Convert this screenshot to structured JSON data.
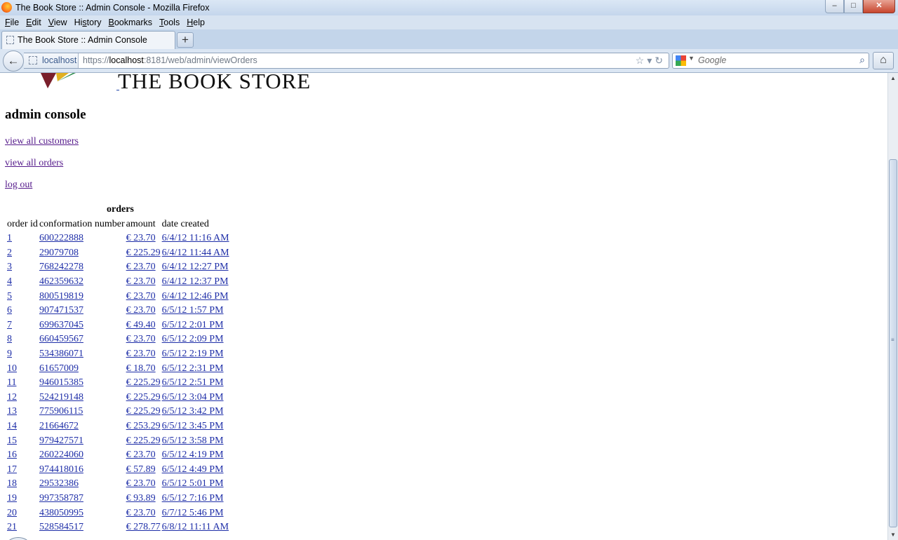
{
  "window": {
    "title": "The Book Store :: Admin Console - Mozilla Firefox",
    "controls": {
      "minimize": "–",
      "maximize": "□",
      "close": "✕"
    }
  },
  "menu": {
    "items": [
      {
        "label": "File",
        "accel": "F"
      },
      {
        "label": "Edit",
        "accel": "E"
      },
      {
        "label": "View",
        "accel": "V"
      },
      {
        "label": "History",
        "accel": "s"
      },
      {
        "label": "Bookmarks",
        "accel": "B"
      },
      {
        "label": "Tools",
        "accel": "T"
      },
      {
        "label": "Help",
        "accel": "H"
      }
    ]
  },
  "tabs": [
    {
      "label": "The Book Store :: Admin Console"
    }
  ],
  "new_tab_label": "+",
  "nav": {
    "back_icon": "back-arrow-icon",
    "identity_label": "localhost",
    "url_prefix": "https://",
    "url_host": "localhost",
    "url_rest": ":8181/web/admin/viewOrders",
    "search_placeholder": "Google",
    "home_icon": "home-icon"
  },
  "page": {
    "logo_text": "THE BOOK STORE",
    "heading": "admin console",
    "links": {
      "customers": "view all customers",
      "orders": "view all orders",
      "logout": "log out"
    },
    "orders_table": {
      "caption": "orders",
      "columns": [
        "order id",
        "conformation number",
        "amount",
        "date created"
      ],
      "rows": [
        [
          "1",
          "600222888",
          "€ 23.70",
          "6/4/12 11:16 AM"
        ],
        [
          "2",
          "29079708",
          "€ 225.29",
          "6/4/12 11:44 AM"
        ],
        [
          "3",
          "768242278",
          "€ 23.70",
          "6/4/12 12:27 PM"
        ],
        [
          "4",
          "462359632",
          "€ 23.70",
          "6/4/12 12:37 PM"
        ],
        [
          "5",
          "800519819",
          "€ 23.70",
          "6/4/12 12:46 PM"
        ],
        [
          "6",
          "907471537",
          "€ 23.70",
          "6/5/12 1:57 PM"
        ],
        [
          "7",
          "699637045",
          "€ 49.40",
          "6/5/12 2:01 PM"
        ],
        [
          "8",
          "660459567",
          "€ 23.70",
          "6/5/12 2:09 PM"
        ],
        [
          "9",
          "534386071",
          "€ 23.70",
          "6/5/12 2:19 PM"
        ],
        [
          "10",
          "61657009",
          "€ 18.70",
          "6/5/12 2:31 PM"
        ],
        [
          "11",
          "946015385",
          "€ 225.29",
          "6/5/12 2:51 PM"
        ],
        [
          "12",
          "524219148",
          "€ 225.29",
          "6/5/12 3:04 PM"
        ],
        [
          "13",
          "775906115",
          "€ 225.29",
          "6/5/12 3:42 PM"
        ],
        [
          "14",
          "21664672",
          "€ 253.29",
          "6/5/12 3:45 PM"
        ],
        [
          "15",
          "979427571",
          "€ 225.29",
          "6/5/12 3:58 PM"
        ],
        [
          "16",
          "260224060",
          "€ 23.70",
          "6/5/12 4:19 PM"
        ],
        [
          "17",
          "974418016",
          "€ 57.89",
          "6/5/12 4:49 PM"
        ],
        [
          "18",
          "29532386",
          "€ 23.70",
          "6/5/12 5:01 PM"
        ],
        [
          "19",
          "997358787",
          "€ 93.89",
          "6/5/12 7:16 PM"
        ],
        [
          "20",
          "438050995",
          "€ 23.70",
          "6/7/12 5:46 PM"
        ],
        [
          "21",
          "528584517",
          "€ 278.77",
          "6/8/12 11:11 AM"
        ]
      ]
    }
  },
  "colors": {
    "link": "#1f2fa8",
    "visited_link": "#551a8b",
    "chrome": "#dbe6f3"
  }
}
